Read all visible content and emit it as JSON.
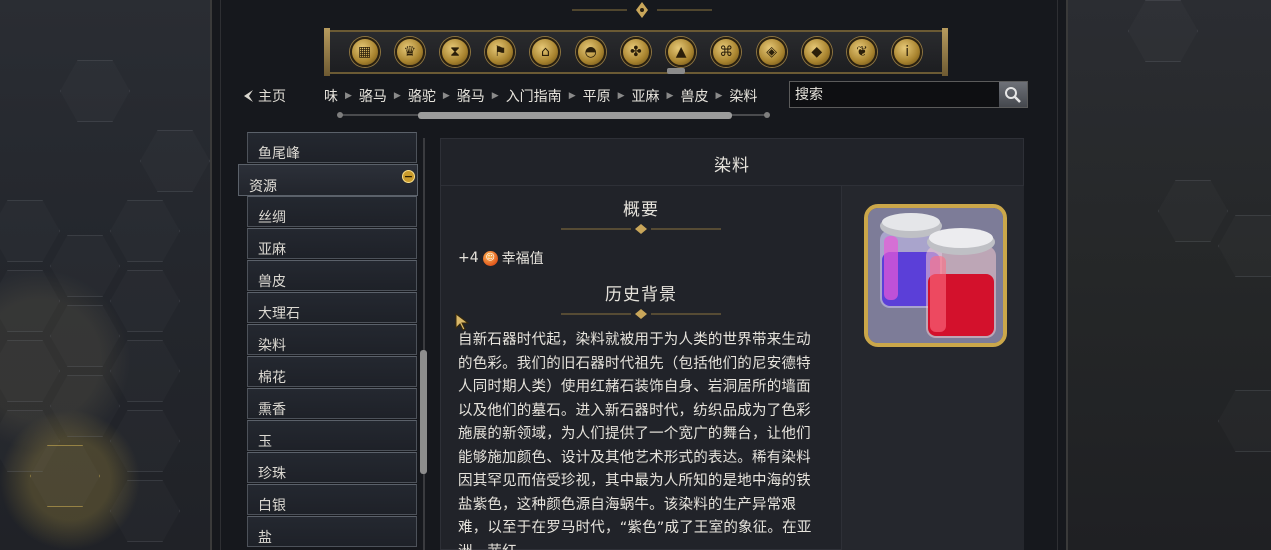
{
  "nav": {
    "home_label": "主页",
    "breadcrumbs": [
      "味",
      "骆马",
      "骆驼",
      "骆马",
      "入门指南",
      "平原",
      "亚麻",
      "兽皮",
      "染料"
    ],
    "search_placeholder": "搜索"
  },
  "category_icons": [
    "buildings-icon",
    "wonder-icon",
    "hourglass-icon",
    "flag-icon",
    "government-icon",
    "resource-icon",
    "units-icon",
    "terrain-icon",
    "district-icon",
    "improvement-icon",
    "policy-icon",
    "religion-icon",
    "info-icon"
  ],
  "sidebar": {
    "items_before": [
      "鱼尾峰"
    ],
    "group_label": "资源",
    "items": [
      "丝绸",
      "亚麻",
      "兽皮",
      "大理石",
      "染料",
      "棉花",
      "熏香",
      "玉",
      "珍珠",
      "白银",
      "盐"
    ]
  },
  "article": {
    "title": "染料",
    "overview_heading": "概要",
    "bonus_value": "+4",
    "bonus_label": "幸福值",
    "history_heading": "历史背景",
    "history_text": "自新石器时代起，染料就被用于为人类的世界带来生动的色彩。我们的旧石器时代祖先（包括他们的尼安德特人同时期人类）使用红赭石装饰自身、岩洞居所的墙面以及他们的墓石。进入新石器时代，纺织品成为了色彩施展的新领域，为人们提供了一个宽广的舞台，让他们能够施加颜色、设计及其他艺术形式的表达。稀有染料因其罕见而倍受珍视，其中最为人所知的是地中海的铁盐紫色，这种颜色源自海蜗牛。该染料的生产异常艰难，以至于在罗马时代，“紫色”成了王室的象征。在亚洲，茜红"
  },
  "colors": {
    "gold": "#cba74a",
    "panel_bg": "#16181d",
    "content_bg": "#212329"
  }
}
